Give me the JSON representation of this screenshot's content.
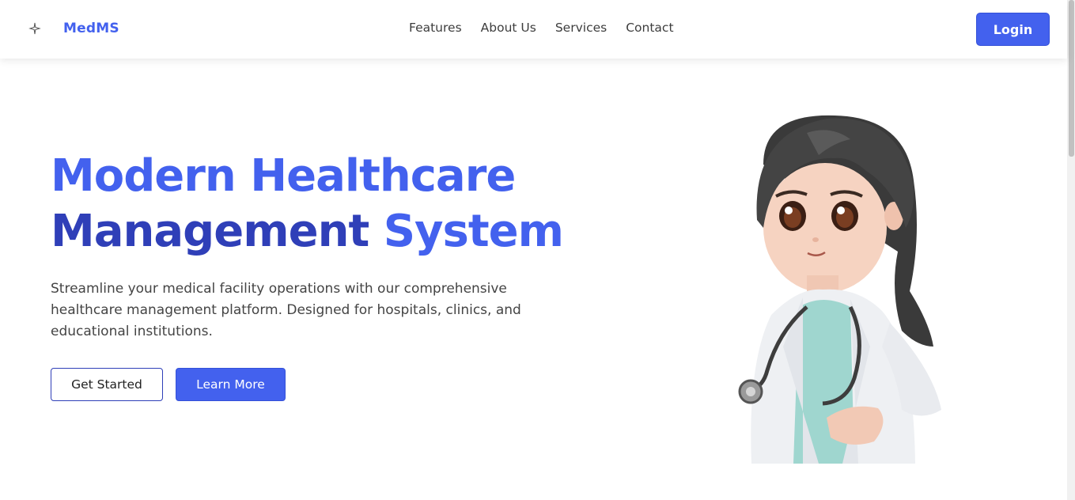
{
  "header": {
    "brand": "MedMS",
    "logo_icon": "sparkle-icon",
    "nav": [
      "Features",
      "About Us",
      "Services",
      "Contact"
    ],
    "login_label": "Login"
  },
  "hero": {
    "title_line1": "Modern Healthcare",
    "title_line2_a": "Management",
    "title_line2_b": "System",
    "description": "Streamline your medical facility operations with our comprehensive healthcare management platform. Designed for hospitals, clinics, and educational institutions.",
    "primary_cta": "Get Started",
    "secondary_cta": "Learn More",
    "illustration": "doctor-character-illustration"
  },
  "colors": {
    "accent": "#4361ee",
    "accent_dark": "#2f3fb8"
  }
}
